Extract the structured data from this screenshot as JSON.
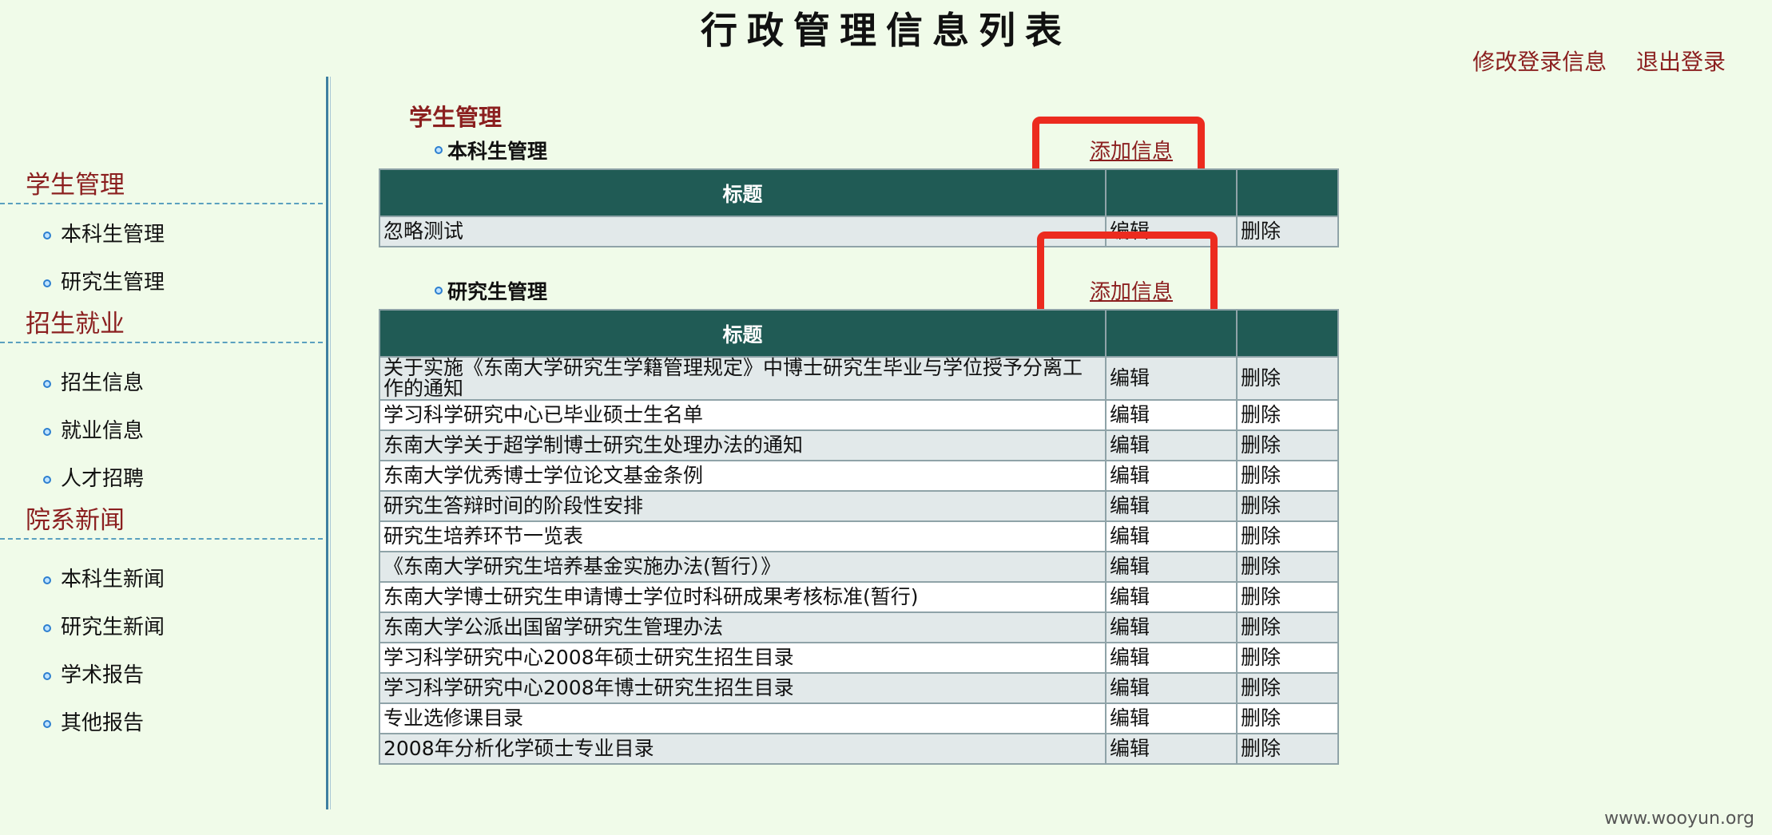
{
  "header": {
    "title": "行政管理信息列表",
    "links": [
      "修改登录信息",
      "退出登录"
    ]
  },
  "sidebar": {
    "groups": [
      {
        "heading": "学生管理",
        "items": [
          "本科生管理",
          "研究生管理"
        ]
      },
      {
        "heading": "招生就业",
        "items": [
          "招生信息",
          "就业信息",
          "人才招聘"
        ]
      },
      {
        "heading": "院系新闻",
        "items": [
          "本科生新闻",
          "研究生新闻",
          "学术报告",
          "其他报告"
        ]
      }
    ]
  },
  "main": {
    "section_title": "学生管理",
    "undergrad": {
      "title": "本科生管理",
      "add_label": "添加信息",
      "table_header": "标题",
      "rows": [
        {
          "title": "忽略测试",
          "edit": "编辑",
          "delete": "删除"
        }
      ]
    },
    "graduate": {
      "title": "研究生管理",
      "add_label": "添加信息",
      "table_header": "标题",
      "rows": [
        {
          "title": "关于实施《东南大学研究生学籍管理规定》中博士研究生毕业与学位授予分离工作的通知",
          "edit": "编辑",
          "delete": "删除"
        },
        {
          "title": "学习科学研究中心已毕业硕士生名单",
          "edit": "编辑",
          "delete": "删除"
        },
        {
          "title": "东南大学关于超学制博士研究生处理办法的通知",
          "edit": "编辑",
          "delete": "删除"
        },
        {
          "title": "东南大学优秀博士学位论文基金条例",
          "edit": "编辑",
          "delete": "删除"
        },
        {
          "title": "研究生答辩时间的阶段性安排",
          "edit": "编辑",
          "delete": "删除"
        },
        {
          "title": "研究生培养环节一览表",
          "edit": "编辑",
          "delete": "删除"
        },
        {
          "title": "《东南大学研究生培养基金实施办法(暂行）》",
          "edit": "编辑",
          "delete": "删除"
        },
        {
          "title": "东南大学博士研究生申请博士学位时科研成果考核标准(暂行)",
          "edit": "编辑",
          "delete": "删除"
        },
        {
          "title": "东南大学公派出国留学研究生管理办法",
          "edit": "编辑",
          "delete": "删除"
        },
        {
          "title": "学习科学研究中心2008年硕士研究生招生目录",
          "edit": "编辑",
          "delete": "删除"
        },
        {
          "title": "学习科学研究中心2008年博士研究生招生目录",
          "edit": "编辑",
          "delete": "删除"
        },
        {
          "title": "专业选修课目录",
          "edit": "编辑",
          "delete": "删除"
        },
        {
          "title": "2008年分析化学硕士专业目录",
          "edit": "编辑",
          "delete": "删除"
        }
      ]
    }
  },
  "watermark": "www.wooyun.org",
  "colors": {
    "background": "#f0fbe9",
    "accent_red": "#8b1f1f",
    "table_header": "#205b55",
    "highlight_box": "#ec2b1f"
  }
}
